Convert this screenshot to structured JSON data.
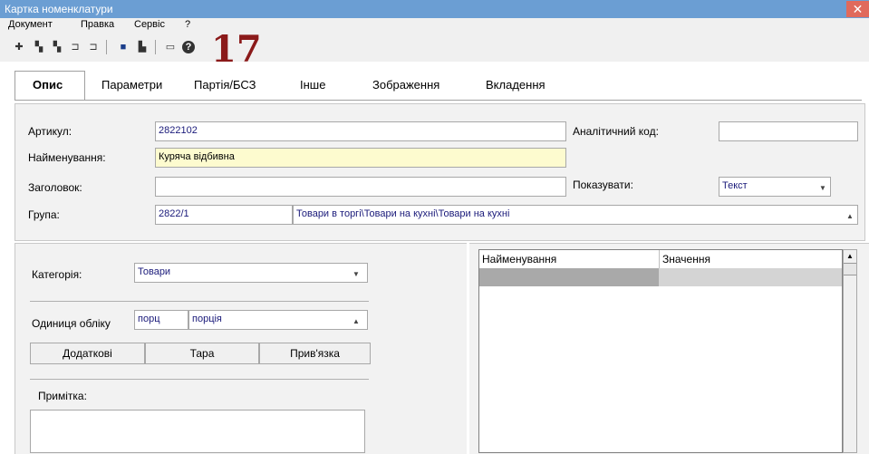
{
  "window": {
    "title": "Картка номенклатури",
    "close_glyph": "✕"
  },
  "menu": [
    "Документ",
    "Правка",
    "Сервіс",
    "?"
  ],
  "toolbar": {
    "icons": [
      "new-doc-icon",
      "copy-icon",
      "paste-icon",
      "undo-icon",
      "redo-icon",
      "save-icon",
      "print-icon",
      "form-icon",
      "help-icon"
    ],
    "annotation": "17"
  },
  "tabs": [
    "Опис",
    "Параметри",
    "Партія/БСЗ",
    "Інше",
    "Зображення",
    "Вкладення"
  ],
  "form": {
    "article_label": "Артикул:",
    "article_value": "2822102",
    "analytic_code_label": "Аналітичний код:",
    "analytic_code_value": "",
    "name_label": "Найменування:",
    "name_value": "Куряча відбивна",
    "heading_label": "Заголовок:",
    "heading_value": "",
    "show_label": "Показувати:",
    "show_value": "Текст",
    "group_label": "Група:",
    "group_code": "2822/1",
    "group_path": "Товари в  торгі\\Товари на кухні\\Товари на кухні"
  },
  "left": {
    "category_label": "Категорія:",
    "category_value": "Товари",
    "unit_label": "Одиниця обліку",
    "unit_code": "порц",
    "unit_name": "порція",
    "buttons": [
      "Додаткові",
      "Тара",
      "Прив'язка"
    ],
    "note_label": "Примітка:"
  },
  "grid": {
    "columns": [
      "Найменування",
      "Значення"
    ]
  },
  "colors": {
    "titlebar": "#6b9ed3",
    "close": "#e06a5c",
    "highlight_field": "#fdfbcf",
    "annotation": "#8b1a1a"
  }
}
